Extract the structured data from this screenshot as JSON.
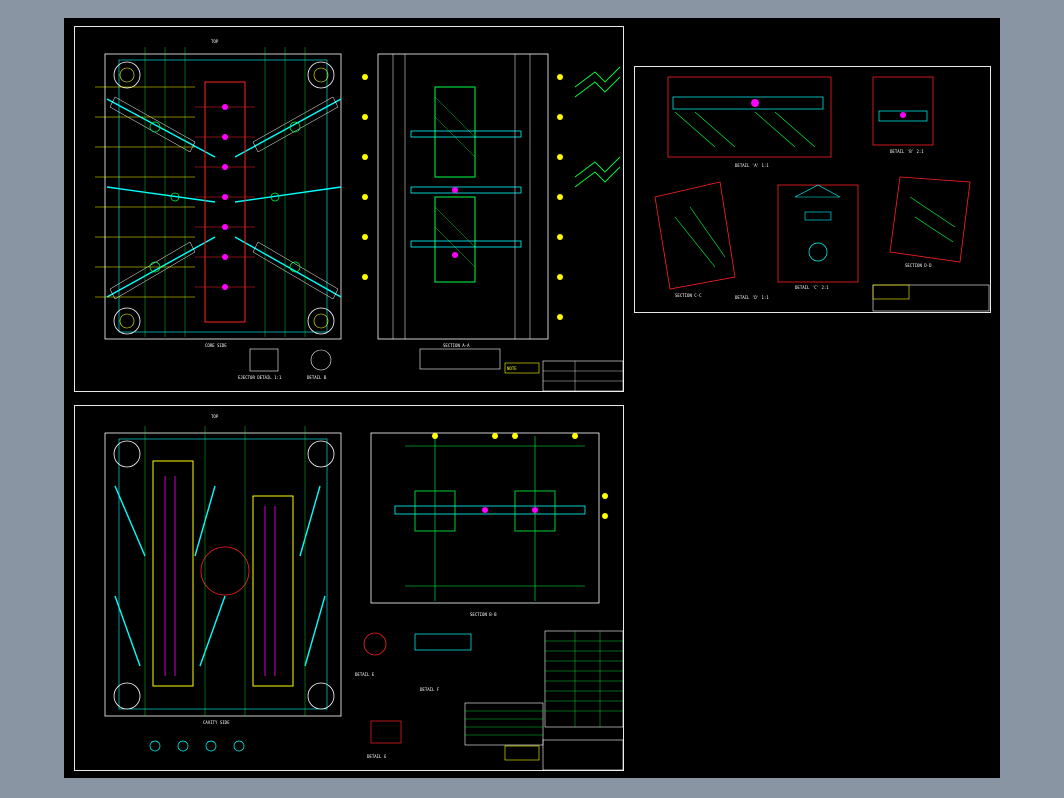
{
  "sheets": {
    "a": {
      "top_title": "TOP",
      "plate_caption": "CORE SIDE",
      "section_caption": "SECTION A-A",
      "detail_caption_1": "EJECTOR DETAIL 1:1",
      "detail_caption_2": "DETAIL B",
      "note_caption": "NOTE"
    },
    "b": {
      "detail_a": "DETAIL 'A' 1:1",
      "detail_b": "DETAIL 'B' 2:1",
      "section_c": "SECTION C-C",
      "detail_c": "DETAIL 'C' 2:1",
      "detail_d": "DETAIL 'D' 1:1",
      "section_d": "SECTION D-D"
    },
    "c": {
      "top_title": "TOP",
      "plate_caption": "CAVITY SIDE",
      "section_caption": "SECTION B-B",
      "detail_caption_1": "DETAIL E",
      "detail_caption_2": "DETAIL F",
      "detail_caption_3": "DETAIL G"
    }
  },
  "colors": {
    "background": "#000000",
    "outline": "#ffffff",
    "cyan": "#00ffff",
    "yellow": "#ffff00",
    "red": "#ff2020",
    "green": "#00ff40",
    "magenta": "#ff00ff"
  }
}
